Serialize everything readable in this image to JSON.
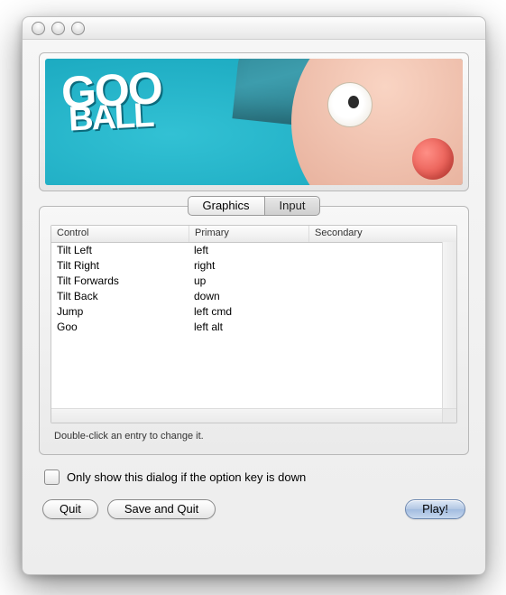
{
  "banner": {
    "logo_line1": "GOO",
    "logo_line2": "BALL"
  },
  "tabs": [
    {
      "label": "Graphics",
      "selected": false
    },
    {
      "label": "Input",
      "selected": true
    }
  ],
  "table": {
    "columns": [
      "Control",
      "Primary",
      "Secondary"
    ],
    "rows": [
      {
        "control": "Tilt Left",
        "primary": "left",
        "secondary": ""
      },
      {
        "control": "Tilt Right",
        "primary": "right",
        "secondary": ""
      },
      {
        "control": "Tilt Forwards",
        "primary": "up",
        "secondary": ""
      },
      {
        "control": "Tilt Back",
        "primary": "down",
        "secondary": ""
      },
      {
        "control": "Jump",
        "primary": "left cmd",
        "secondary": ""
      },
      {
        "control": "Goo",
        "primary": "left alt",
        "secondary": ""
      }
    ],
    "hint": "Double-click an entry to change it."
  },
  "checkbox": {
    "checked": false,
    "label": "Only show this dialog if the option key is down"
  },
  "buttons": {
    "quit": "Quit",
    "save_and_quit": "Save and Quit",
    "play": "Play!"
  }
}
